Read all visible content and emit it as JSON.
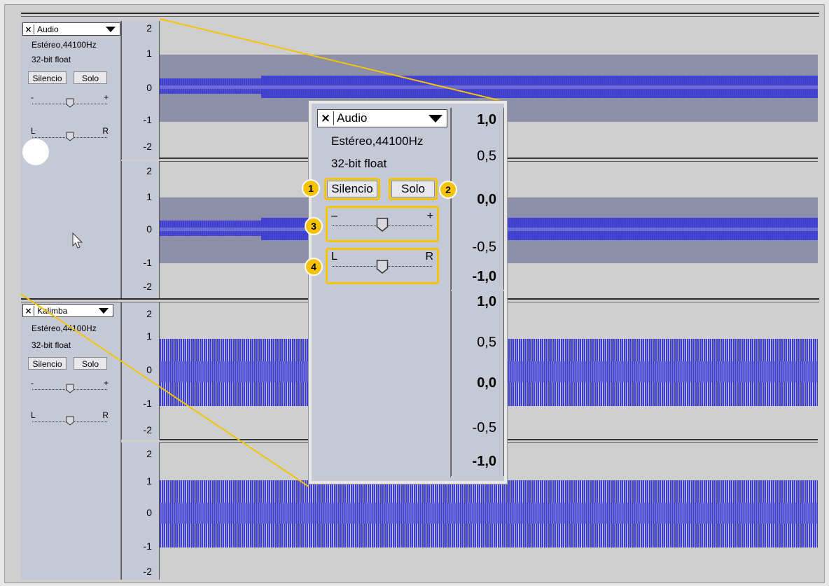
{
  "tracks": [
    {
      "name": "Audio",
      "format": "Estéreo,44100Hz",
      "bitdepth": "32-bit float",
      "mute_label": "Silencio",
      "solo_label": "Solo",
      "gain_min": "-",
      "gain_max": "+",
      "pan_left": "L",
      "pan_right": "R",
      "scale": [
        "2",
        "1",
        "0",
        "-1",
        "-2"
      ],
      "scale2": [
        "2",
        "1",
        "0",
        "-1",
        "-2"
      ]
    },
    {
      "name": "Kalimba",
      "format": "Estéreo,44100Hz",
      "bitdepth": "32-bit float",
      "mute_label": "Silencio",
      "solo_label": "Solo",
      "gain_min": "-",
      "gain_max": "+",
      "pan_left": "L",
      "pan_right": "R",
      "scale": [
        "2",
        "1",
        "0",
        "-1",
        "-2"
      ],
      "scale2": [
        "2",
        "1",
        "0",
        "-1",
        "-2"
      ]
    }
  ],
  "zoom": {
    "name": "Audio",
    "format": "Estéreo,44100Hz",
    "bitdepth": "32-bit float",
    "mute_label": "Silencio",
    "solo_label": "Solo",
    "gain_min": "–",
    "gain_max": "+",
    "pan_left": "L",
    "pan_right": "R",
    "scale_top": [
      "1,0",
      "0,5",
      "0,0",
      "-0,5",
      "-1,0"
    ],
    "scale_bottom": [
      "1,0",
      "0,5",
      "0,0",
      "-0,5",
      "-1,0"
    ],
    "badges": [
      "1",
      "2",
      "3",
      "4"
    ]
  },
  "colors": {
    "wave": "#3f3fcf",
    "wave_inner": "#6c6cd6",
    "highlight": "#f4c400",
    "selection": "#8d8fa8"
  }
}
